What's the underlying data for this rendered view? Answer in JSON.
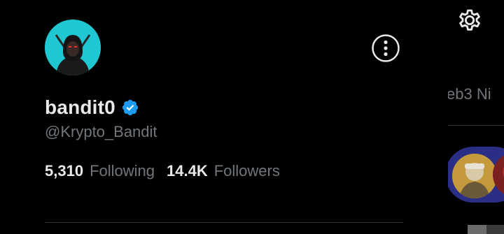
{
  "profile": {
    "display_name": "bandit0",
    "handle": "@Krypto_Bandit",
    "verified": true,
    "avatar_icon": "ninja-avatar",
    "stats": {
      "following_count": "5,310",
      "following_label": "Following",
      "followers_count": "14.4K",
      "followers_label": "Followers"
    }
  },
  "icons": {
    "more": "more-options-icon",
    "verified": "verified-badge-icon",
    "settings": "gear-icon"
  },
  "sidebar": {
    "trend_text": "eb3 Ni"
  },
  "colors": {
    "background": "#000000",
    "text_primary": "#e7e9ea",
    "text_secondary": "#71767b",
    "verified_blue": "#1d9bf0",
    "avatar_bg": "#1fc7d2",
    "divider": "#2f3336",
    "space_card": "#2a2f85"
  }
}
